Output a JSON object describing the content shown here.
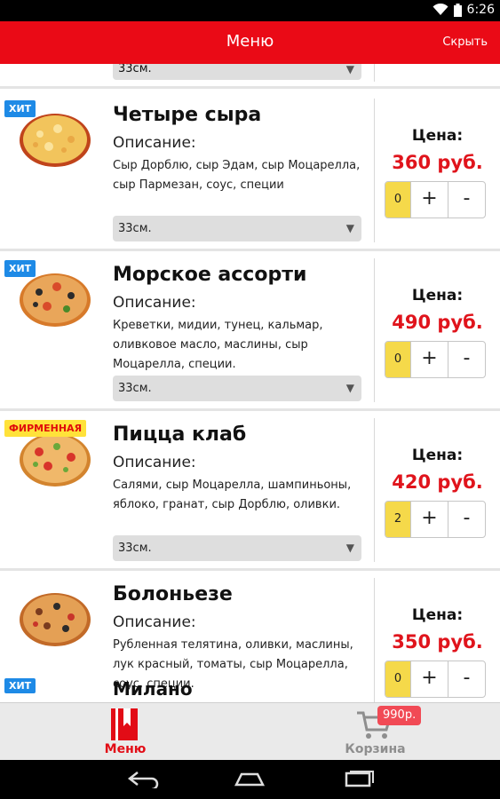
{
  "status_bar": {
    "time": "6:26"
  },
  "action_bar": {
    "title": "Меню",
    "hide_label": "Скрыть"
  },
  "common": {
    "description_label": "Описание:",
    "price_label": "Цена:",
    "plus": "+",
    "minus": "-"
  },
  "partial_item": {
    "size": "33см."
  },
  "items": [
    {
      "badge": "ХИТ",
      "name": "Четыре сыра",
      "description": "Сыр Дорблю, сыр Эдам, сыр Моцарелла, сыр Пармезан, соус, специи",
      "size": "33см.",
      "price": "360 руб.",
      "quantity": "0"
    },
    {
      "badge": "ХИТ",
      "name": "Морское ассорти",
      "description": "Креветки, мидии, тунец, кальмар, оливковое масло, маслины, сыр Моцарелла, специи.",
      "size": "33см.",
      "price": "490 руб.",
      "quantity": "0"
    },
    {
      "badge": "ФИРМЕННАЯ",
      "name": "Пицца клаб",
      "description": "Салями, сыр Моцарелла, шампиньоны, яблоко, гранат, сыр Дорблю, оливки.",
      "size": "33см.",
      "price": "420 руб.",
      "quantity": "2"
    },
    {
      "name": "Болоньезе",
      "description": "Рубленная телятина, оливки, маслины, лук красный, томаты, сыр Моцарелла, соус, специи.",
      "price": "350 руб.",
      "quantity": "0"
    }
  ],
  "ghost_item": {
    "badge": "ХИТ",
    "name": "Милано"
  },
  "bottom_bar": {
    "menu_label": "Меню",
    "cart_label": "Корзина",
    "cart_total": "990р."
  },
  "colors": {
    "brand_red": "#ea0a16",
    "price_red": "#e0141c",
    "quantity_yellow": "#f5d94a",
    "hit_blue": "#1e8ae6",
    "brand_badge_yellow": "#ffe23a"
  }
}
